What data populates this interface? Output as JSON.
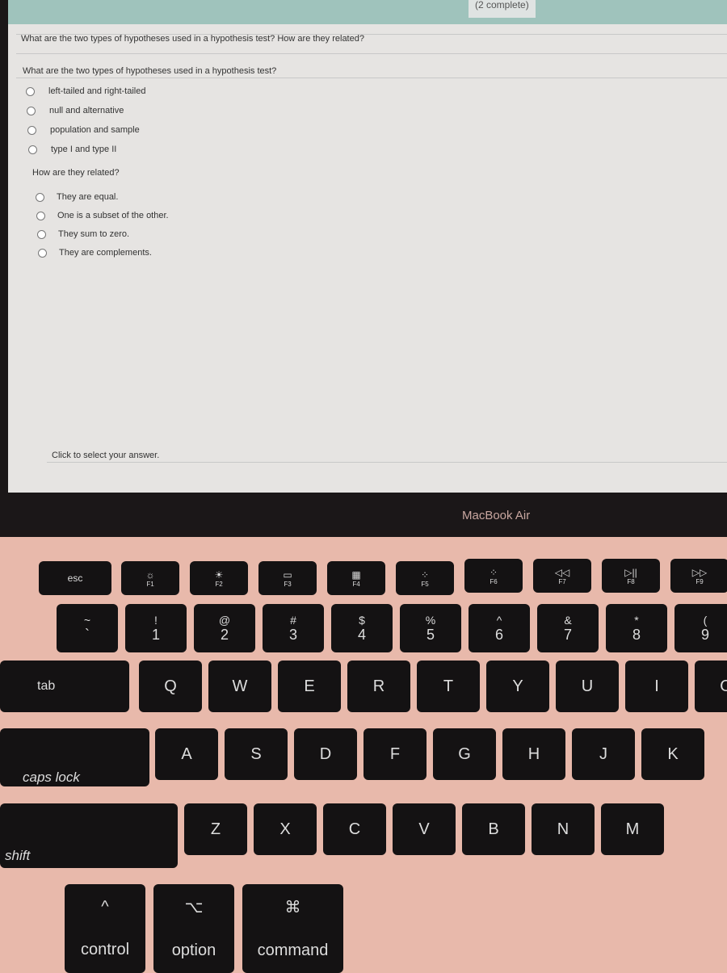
{
  "header": {
    "progress": "(2 complete)"
  },
  "question": {
    "title": "What are the two types of hypotheses used in a hypothesis test? How are they related?",
    "part1": "What are the two types of hypotheses used in a hypothesis test?",
    "options1": [
      "left-tailed and right-tailed",
      "null and alternative",
      "population and sample",
      "type I and type II"
    ],
    "part2": "How are they related?",
    "options2": [
      "They are equal.",
      "One is a subset of the other.",
      "They sum to zero.",
      "They are complements."
    ],
    "footer": "Click to select your answer."
  },
  "device": {
    "brand": "MacBook Air"
  },
  "keyboard": {
    "fn": [
      {
        "l": "esc"
      },
      {
        "l": "F1",
        "i": "☼"
      },
      {
        "l": "F2",
        "i": "☀"
      },
      {
        "l": "F3",
        "i": "▭"
      },
      {
        "l": "F4",
        "i": "▦"
      },
      {
        "l": "F5",
        "i": "⁘"
      },
      {
        "l": "F6",
        "i": "⁘"
      },
      {
        "l": "F7",
        "i": "◁◁"
      },
      {
        "l": "F8",
        "i": "▷||"
      },
      {
        "l": "F9",
        "i": "▷▷"
      }
    ],
    "num": [
      [
        "~",
        "`"
      ],
      [
        "!",
        "1"
      ],
      [
        "@",
        "2"
      ],
      [
        "#",
        "3"
      ],
      [
        "$",
        "4"
      ],
      [
        "%",
        "5"
      ],
      [
        "^",
        "6"
      ],
      [
        "&",
        "7"
      ],
      [
        "*",
        "8"
      ],
      [
        "(",
        "9"
      ]
    ],
    "row1": [
      "Q",
      "W",
      "E",
      "R",
      "T",
      "Y",
      "U",
      "I",
      "O"
    ],
    "row2": [
      "A",
      "S",
      "D",
      "F",
      "G",
      "H",
      "J",
      "K"
    ],
    "row3": [
      "Z",
      "X",
      "C",
      "V",
      "B",
      "N",
      "M"
    ],
    "tab": "tab",
    "caps": "caps lock",
    "shift": "shift",
    "control": "control",
    "option": "option",
    "command": "command",
    "control_sym": "^",
    "option_sym": "⌥",
    "command_sym": "⌘"
  }
}
